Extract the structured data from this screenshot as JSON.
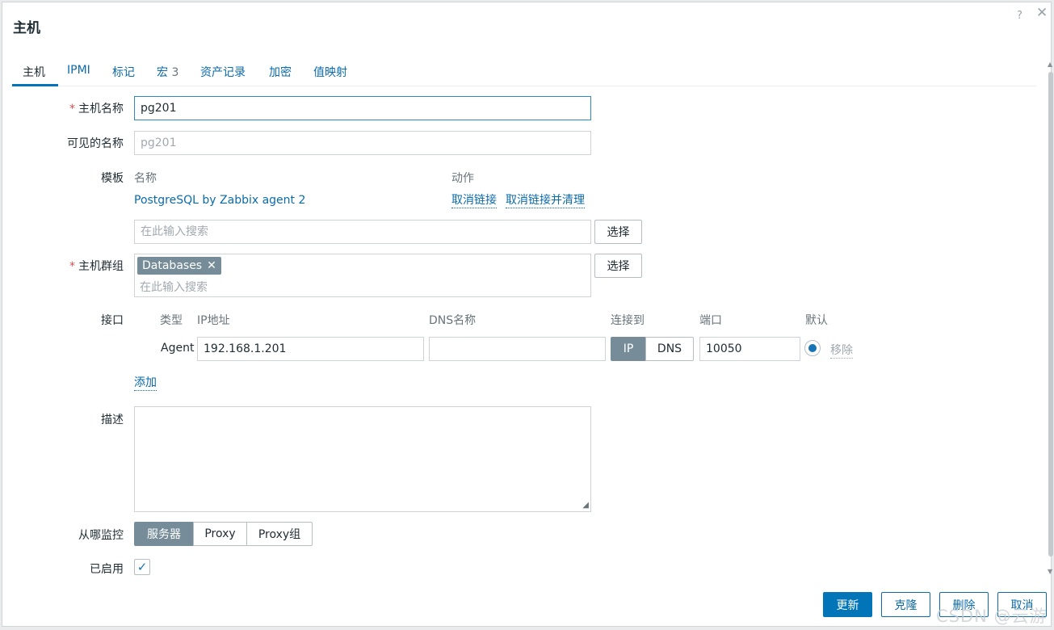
{
  "dialog": {
    "title": "主机",
    "help": "?",
    "close": "✕"
  },
  "tabs": [
    {
      "label": "主机"
    },
    {
      "label": "IPMI"
    },
    {
      "label": "标记"
    },
    {
      "label": "宏",
      "count": "3"
    },
    {
      "label": "资产记录"
    },
    {
      "label": "加密"
    },
    {
      "label": "值映射"
    }
  ],
  "form": {
    "required_mark": "*",
    "host_name": {
      "label": "主机名称",
      "value": "pg201"
    },
    "visible_name": {
      "label": "可见的名称",
      "placeholder": "pg201"
    },
    "templates": {
      "label": "模板",
      "col_name": "名称",
      "col_action": "动作",
      "linked": "PostgreSQL by Zabbix agent 2",
      "unlink": "取消链接",
      "unlink_clear": "取消链接并清理",
      "search_placeholder": "在此输入搜索",
      "select_label": "选择"
    },
    "host_groups": {
      "label": "主机群组",
      "chip": "Databases",
      "chip_remove": "✕",
      "search_placeholder": "在此输入搜索",
      "select_label": "选择"
    },
    "interfaces": {
      "label": "接口",
      "col_type": "类型",
      "col_ip": "IP地址",
      "col_dns": "DNS名称",
      "col_connect": "连接到",
      "col_port": "端口",
      "col_default": "默认",
      "row": {
        "type": "Agent",
        "ip": "192.168.1.201",
        "dns": "",
        "connect_ip": "IP",
        "connect_dns": "DNS",
        "port": "10050",
        "remove": "移除"
      },
      "add": "添加"
    },
    "description": {
      "label": "描述",
      "value": ""
    },
    "monitored_by": {
      "label": "从哪监控",
      "options": [
        "服务器",
        "Proxy",
        "Proxy组"
      ]
    },
    "enabled": {
      "label": "已启用",
      "check": "✓"
    }
  },
  "footer": {
    "update": "更新",
    "clone": "克隆",
    "delete": "删除",
    "cancel": "取消"
  },
  "scroll": {
    "up": "▲",
    "down": "▼"
  },
  "watermark": "CSDN @云游"
}
